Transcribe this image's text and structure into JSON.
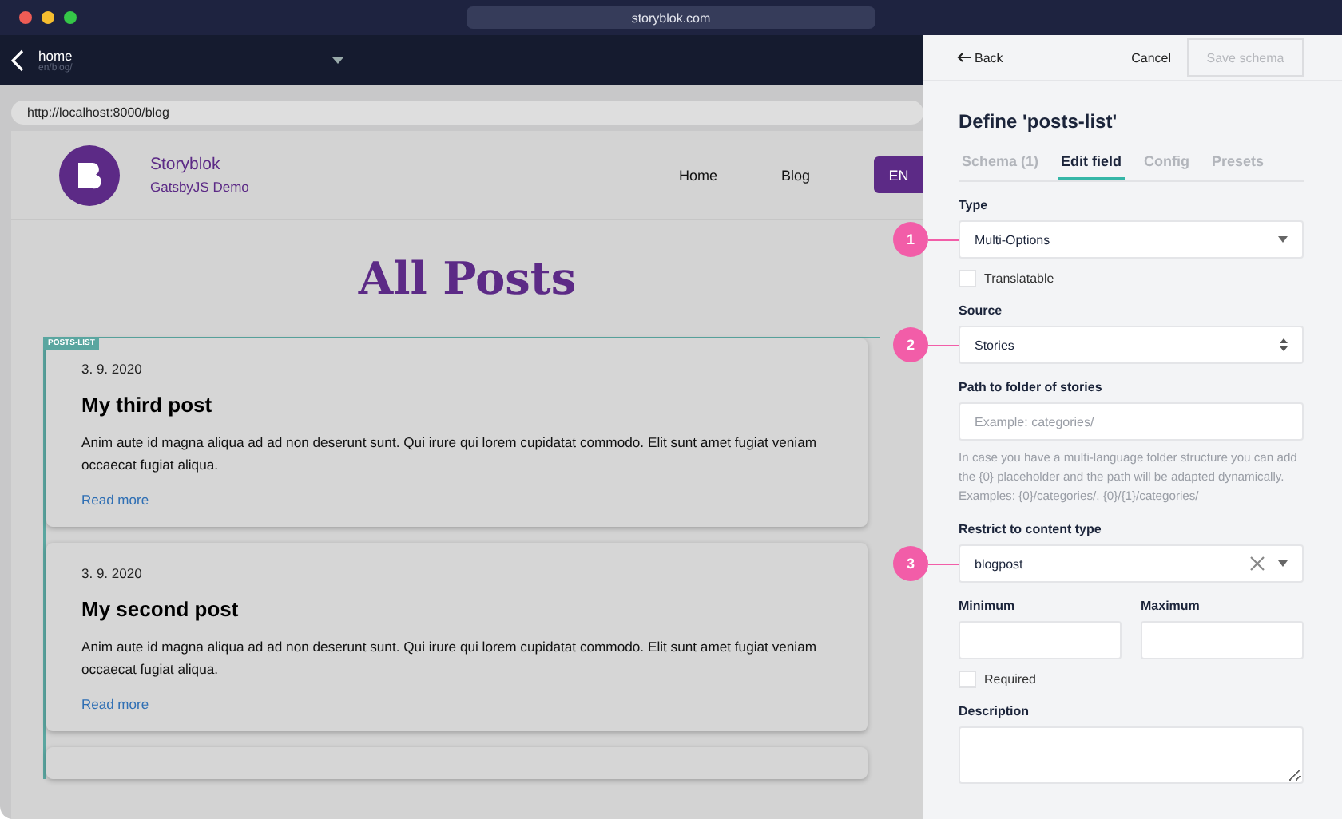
{
  "window": {
    "address": "storyblok.com"
  },
  "story": {
    "title": "home",
    "path": "en/blog/"
  },
  "preview": {
    "url": "http://localhost:8000/blog",
    "site": {
      "brand": "Storyblok",
      "subtitle": "GatsbyJS Demo",
      "nav": [
        "Home",
        "Blog"
      ],
      "language": "EN"
    },
    "heading": "All Posts",
    "block_tag": "POSTS-LIST",
    "posts": [
      {
        "date": "3. 9. 2020",
        "title": "My third post",
        "body": "Anim aute id magna aliqua ad ad non deserunt sunt. Qui irure qui lorem cupidatat commodo. Elit sunt amet fugiat veniam occaecat fugiat aliqua.",
        "link": "Read more"
      },
      {
        "date": "3. 9. 2020",
        "title": "My second post",
        "body": "Anim aute id magna aliqua ad ad non deserunt sunt. Qui irure qui lorem cupidatat commodo. Elit sunt amet fugiat veniam occaecat fugiat aliqua.",
        "link": "Read more"
      }
    ]
  },
  "panel": {
    "back": "Back",
    "cancel": "Cancel",
    "save": {
      "label": "Save schema",
      "disabled": true
    },
    "title": "Define 'posts-list'",
    "tabs": [
      {
        "label": "Schema (1)",
        "selected": false
      },
      {
        "label": "Edit field",
        "selected": true
      },
      {
        "label": "Config",
        "selected": false
      },
      {
        "label": "Presets",
        "selected": false
      }
    ],
    "fields": [
      {
        "kind": "select",
        "label": "Type",
        "value": "Multi-Options",
        "callout": "1"
      },
      {
        "kind": "checkbox",
        "label": "Translatable",
        "checked": false
      },
      {
        "kind": "spinner",
        "label": "Source",
        "value": "Stories",
        "callout": "2"
      },
      {
        "kind": "text",
        "label": "Path to folder of stories",
        "placeholder": "Example: categories/",
        "help": "In case you have a multi-language folder structure you can add the {0} placeholder and the path will be adapted dynamically. Examples: {0}/categories/, {0}/{1}/categories/"
      },
      {
        "kind": "clearable",
        "label": "Restrict to content type",
        "value": "blogpost",
        "callout": "3"
      },
      {
        "kind": "pair",
        "items": [
          {
            "label": "Minimum"
          },
          {
            "label": "Maximum"
          }
        ]
      },
      {
        "kind": "checkbox",
        "label": "Required",
        "checked": false
      },
      {
        "kind": "textarea",
        "label": "Description"
      }
    ]
  }
}
